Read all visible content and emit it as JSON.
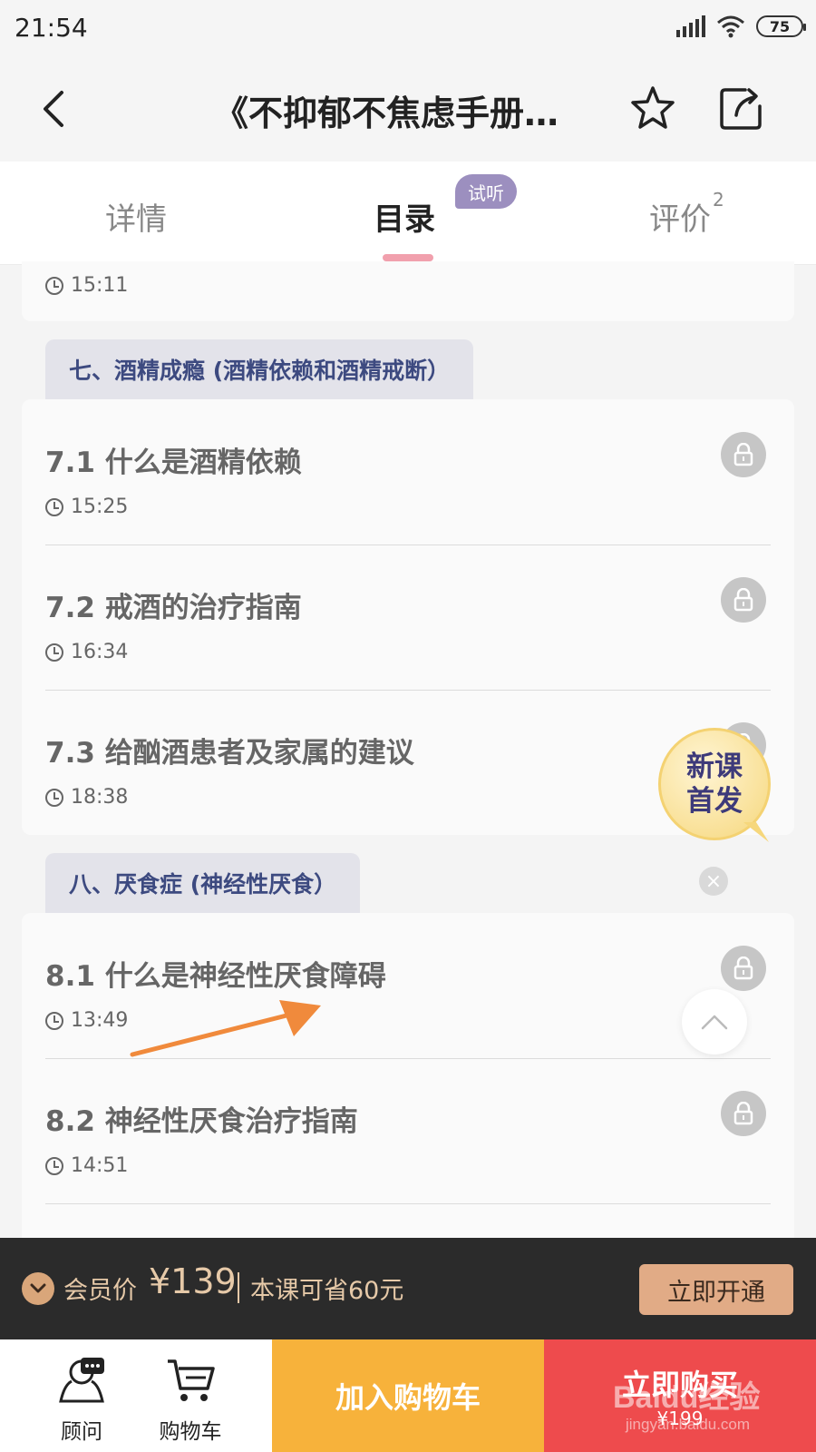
{
  "status_bar": {
    "time": "21:54",
    "battery": "75",
    "signal_icon": "signal-icon",
    "wifi_icon": "wifi-icon"
  },
  "header": {
    "title": "《不抑郁不焦虑手册…",
    "back_icon": "back-icon",
    "star_icon": "star-icon",
    "share_icon": "share-icon"
  },
  "tabs": [
    {
      "label": "详情"
    },
    {
      "label": "目录",
      "badge": "试听"
    },
    {
      "label": "评价",
      "count": "2"
    }
  ],
  "prev_item": {
    "duration": "15:11"
  },
  "sections": [
    {
      "title": "七、酒精成瘾 (酒精依赖和酒精戒断）",
      "lessons": [
        {
          "title": "7.1 什么是酒精依赖",
          "duration": "15:25"
        },
        {
          "title": "7.2 戒酒的治疗指南",
          "duration": "16:34"
        },
        {
          "title": "7.3 给酗酒患者及家属的建议",
          "duration": "18:38"
        }
      ]
    },
    {
      "title": "八、厌食症 (神经性厌食）",
      "lessons": [
        {
          "title": "8.1 什么是神经性厌食障碍",
          "duration": "13:49"
        },
        {
          "title": "8.2 神经性厌食治疗指南",
          "duration": "14:51"
        }
      ]
    }
  ],
  "promo": {
    "line1": "新课",
    "line2": "首发"
  },
  "close_symbol": "×",
  "member_bar": {
    "label": "会员价",
    "price": "¥139",
    "save": "本课可省60元",
    "button": "立即开通"
  },
  "bottom_bar": {
    "advisor": "顾问",
    "cart": "购物车",
    "add_to_cart": "加入购物车",
    "buy_now": "立即购买",
    "buy_price": "¥199"
  },
  "watermark": {
    "text": "Baidu经验",
    "url": "jingyan.baidu.com"
  },
  "colors": {
    "accent_pink": "#f1a0ad",
    "cart_orange": "#f7b23b",
    "buy_red": "#ee4b4d",
    "member_gold": "#e1ab86",
    "section_blue": "#3d4a80"
  }
}
